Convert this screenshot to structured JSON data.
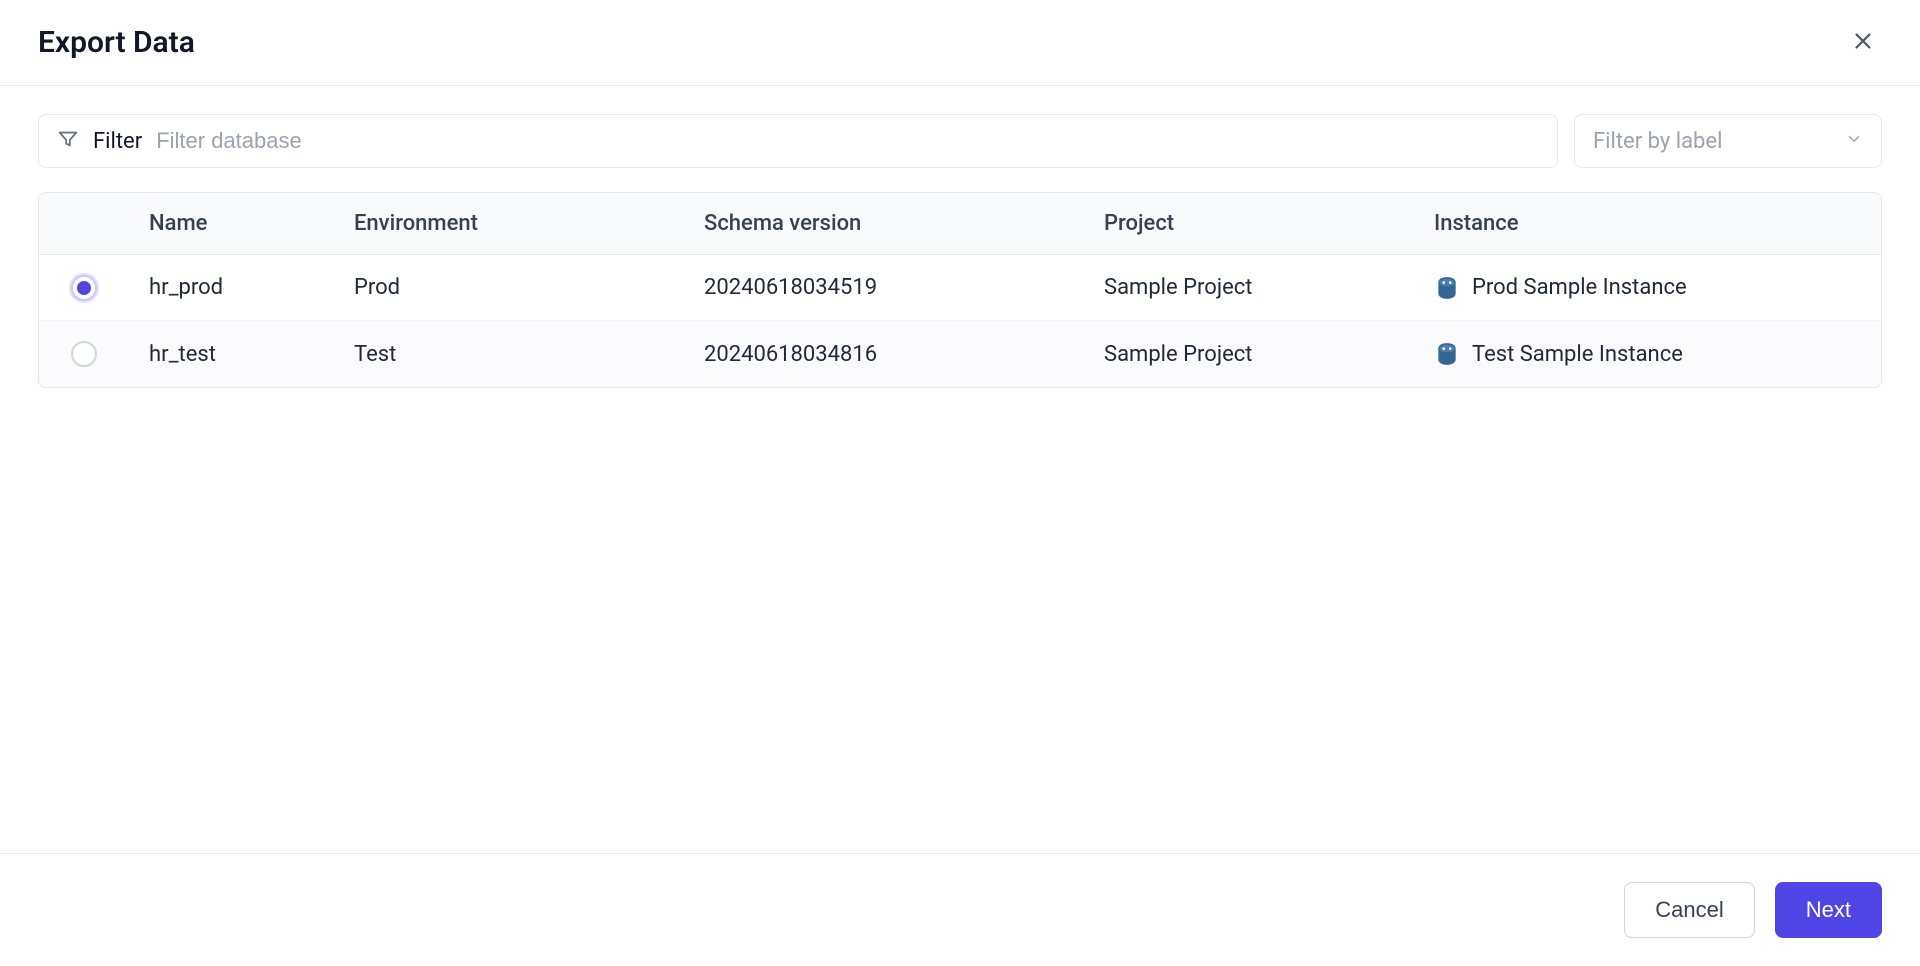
{
  "dialog": {
    "title": "Export Data"
  },
  "filters": {
    "label": "Filter",
    "placeholder": "Filter database",
    "labelSelectPlaceholder": "Filter by label"
  },
  "table": {
    "headers": {
      "name": "Name",
      "environment": "Environment",
      "schemaVersion": "Schema version",
      "project": "Project",
      "instance": "Instance"
    },
    "rows": [
      {
        "selected": true,
        "name": "hr_prod",
        "environment": "Prod",
        "schemaVersion": "20240618034519",
        "project": "Sample Project",
        "instance": "Prod Sample Instance"
      },
      {
        "selected": false,
        "name": "hr_test",
        "environment": "Test",
        "schemaVersion": "20240618034816",
        "project": "Sample Project",
        "instance": "Test Sample Instance"
      }
    ]
  },
  "footer": {
    "cancel": "Cancel",
    "next": "Next"
  }
}
